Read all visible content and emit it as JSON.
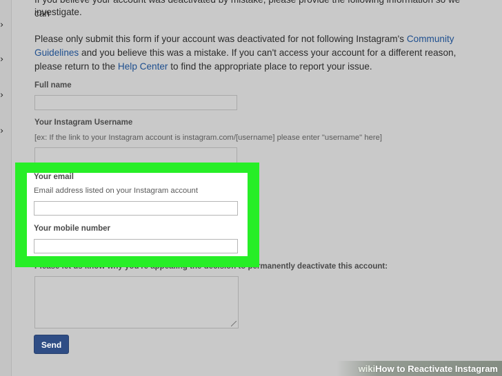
{
  "nav": {
    "chevrons": [
      "›",
      "›",
      "›",
      "›"
    ]
  },
  "intro": {
    "line_partial": "If you believe your account was deactivated by mistake, please provide the following information so we can",
    "line_end": "investigate."
  },
  "policy": {
    "p1": "Please only submit this form if your account was deactivated for not following Instagram's ",
    "link1": "Community Guidelines",
    "p2": " and you believe this was a mistake. If you can't access your account for a different reason, please return to the ",
    "link2": "Help Center",
    "p3": " to find the appropriate place to report your issue."
  },
  "form": {
    "full_name_label": "Full name",
    "username_label": "Your Instagram Username",
    "username_hint": "[ex: If the link to your Instagram account is instagram.com/[username] please enter \"username\" here]",
    "email_label": "Your email",
    "email_hint": "Email address listed on your Instagram account",
    "mobile_label": "Your mobile number",
    "appeal_label": "Please let us know why you're appealing the decision to permanently deactivate this account:",
    "send_label": "Send"
  },
  "watermark": {
    "wiki": "wiki",
    "how": "How",
    "rest": " to Reactivate Instagram"
  },
  "colors": {
    "highlight": "#27ee27",
    "link": "#1e4f8f",
    "button": "#2f4d85"
  }
}
